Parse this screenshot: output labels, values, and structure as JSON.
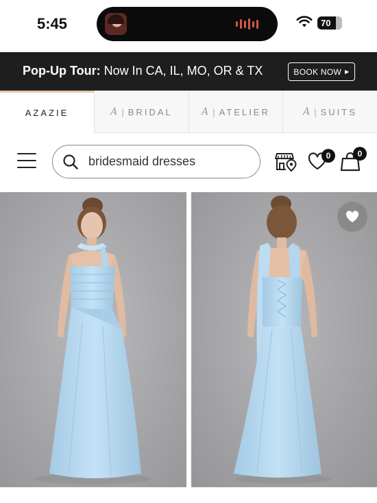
{
  "status_bar": {
    "time": "5:45",
    "battery": "70",
    "icons": [
      "now-playing-avatar",
      "audio-wave-icon",
      "wifi-icon",
      "battery-icon"
    ]
  },
  "promo": {
    "lead": "Pop-Up Tour:",
    "text": " Now In CA, IL, MO, OR & TX",
    "button_label": "BOOK NOW"
  },
  "brand_tabs": [
    {
      "label": "AZAZIE",
      "active": true
    },
    {
      "label": "BRIDAL",
      "active": false
    },
    {
      "label": "ATELIER",
      "active": false
    },
    {
      "label": "SUITS",
      "active": false
    }
  ],
  "header": {
    "search_value": "bridesmaid dresses",
    "wishlist_count": "0",
    "cart_count": "0",
    "icons": [
      "menu-icon",
      "search-icon",
      "store-locator-icon",
      "heart-icon",
      "shopping-bag-icon"
    ]
  },
  "products": [
    {
      "alt": "Model in light blue strapless dress with scarf, front view",
      "dress_color": "#b9dcf3"
    },
    {
      "alt": "Model in light blue dress with scarf, back view",
      "dress_color": "#b9dcf3",
      "favorite_icon": "heart-icon"
    }
  ],
  "colors": {
    "promo_bg": "#1e1e1e",
    "tab_accent": "#e8c6a8",
    "photo_bg": "#a6a6a8",
    "dress": "#b9dcf3"
  }
}
